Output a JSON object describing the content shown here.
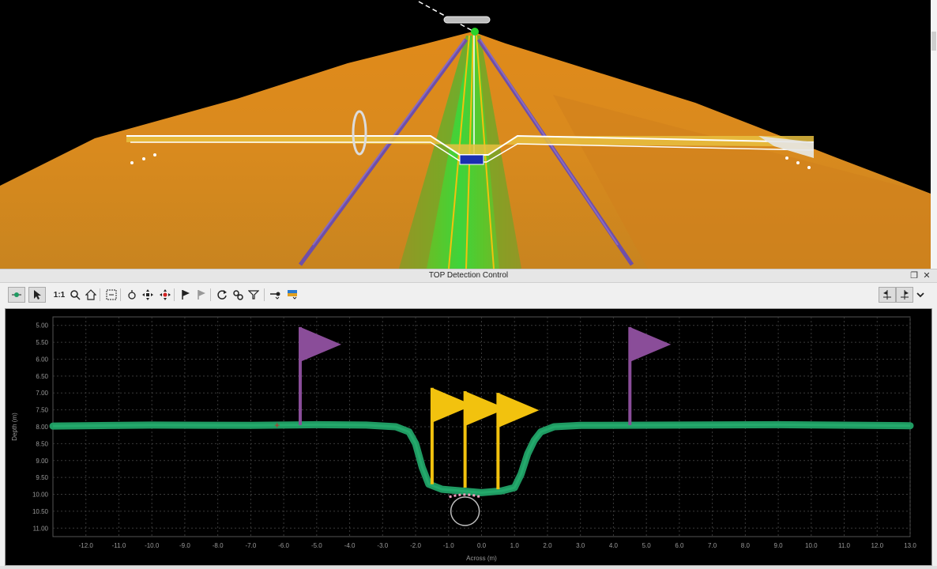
{
  "panel": {
    "title": "TOP Detection Control",
    "restore_icon": "restore-window-icon",
    "close_icon": "close-icon"
  },
  "toolbar": {
    "scale_label": "1:1",
    "tools": [
      "toggle-display-icon",
      "pointer-icon",
      "scale-1to1",
      "zoom-icon",
      "home-icon",
      "zoom-region-icon",
      "pin-icon",
      "pan-icon",
      "move-points-icon",
      "flag-add-icon",
      "flag-remove-icon",
      "refresh-icon",
      "settings-icon",
      "filter-icon",
      "target-dropdown-icon",
      "color-dropdown-icon"
    ],
    "right_tools": [
      "flag-left-icon",
      "flag-right-icon",
      "chevron-down-icon"
    ]
  },
  "colors": {
    "seabed_points": "#1f9a62",
    "manual_flag": "#8a4d99",
    "detected_flag": "#f2c20e",
    "plot_bg": "#000000",
    "grid": "#3a3a3a",
    "pipe_marker": "#bdbdbd",
    "seabed_3d": "#d98a1e"
  },
  "chart_data": {
    "type": "scatter",
    "title": "",
    "xlabel": "Across (m)",
    "ylabel": "Depth (m)",
    "xlim": [
      -13.0,
      13.0
    ],
    "ylim": [
      11.25,
      4.75
    ],
    "y_inverted": true,
    "grid": true,
    "xticks": [
      "-12.0",
      "-11.0",
      "-10.0",
      "-9.0",
      "-8.0",
      "-7.0",
      "-6.0",
      "-5.0",
      "-4.0",
      "-3.0",
      "-2.0",
      "-1.0",
      "0.0",
      "1.0",
      "2.0",
      "3.0",
      "4.0",
      "5.0",
      "6.0",
      "7.0",
      "8.0",
      "9.0",
      "10.0",
      "11.0",
      "12.0",
      "13.0"
    ],
    "yticks": [
      "5.00",
      "5.50",
      "6.00",
      "6.50",
      "7.00",
      "7.50",
      "8.00",
      "8.50",
      "9.00",
      "9.50",
      "10.00",
      "10.50",
      "11.00"
    ],
    "profile": {
      "x": [
        -13.0,
        -10.0,
        -7.0,
        -5.0,
        -3.5,
        -2.6,
        -2.2,
        -2.0,
        -1.8,
        -1.6,
        -1.2,
        -0.6,
        0.0,
        0.6,
        1.0,
        1.2,
        1.4,
        1.6,
        1.8,
        2.2,
        3.0,
        6.0,
        9.0,
        13.0
      ],
      "y": [
        7.98,
        7.95,
        7.96,
        7.94,
        7.95,
        8.0,
        8.15,
        8.5,
        9.2,
        9.7,
        9.85,
        9.9,
        9.95,
        9.9,
        9.8,
        9.4,
        8.8,
        8.4,
        8.15,
        8.0,
        7.96,
        7.95,
        7.94,
        7.97
      ]
    },
    "manual_flags": [
      {
        "x": -5.5,
        "y": 7.95
      },
      {
        "x": 4.5,
        "y": 7.95
      }
    ],
    "detected_flags": [
      {
        "x": -1.5,
        "y": 9.7
      },
      {
        "x": -0.5,
        "y": 9.8
      },
      {
        "x": 0.5,
        "y": 9.85
      }
    ],
    "marker_plus": {
      "x": -6.2,
      "y": 7.95
    },
    "pipe_circle": {
      "x": -0.5,
      "y": 10.5
    }
  }
}
